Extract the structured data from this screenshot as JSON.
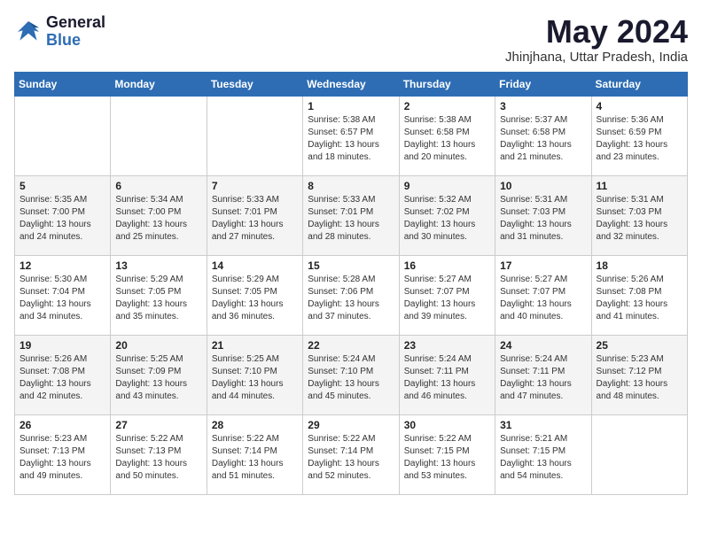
{
  "header": {
    "logo_general": "General",
    "logo_blue": "Blue",
    "month_title": "May 2024",
    "location": "Jhinjhana, Uttar Pradesh, India"
  },
  "days_of_week": [
    "Sunday",
    "Monday",
    "Tuesday",
    "Wednesday",
    "Thursday",
    "Friday",
    "Saturday"
  ],
  "weeks": [
    [
      {
        "day": "",
        "sunrise": "",
        "sunset": "",
        "daylight": ""
      },
      {
        "day": "",
        "sunrise": "",
        "sunset": "",
        "daylight": ""
      },
      {
        "day": "",
        "sunrise": "",
        "sunset": "",
        "daylight": ""
      },
      {
        "day": "1",
        "sunrise": "Sunrise: 5:38 AM",
        "sunset": "Sunset: 6:57 PM",
        "daylight": "Daylight: 13 hours and 18 minutes."
      },
      {
        "day": "2",
        "sunrise": "Sunrise: 5:38 AM",
        "sunset": "Sunset: 6:58 PM",
        "daylight": "Daylight: 13 hours and 20 minutes."
      },
      {
        "day": "3",
        "sunrise": "Sunrise: 5:37 AM",
        "sunset": "Sunset: 6:58 PM",
        "daylight": "Daylight: 13 hours and 21 minutes."
      },
      {
        "day": "4",
        "sunrise": "Sunrise: 5:36 AM",
        "sunset": "Sunset: 6:59 PM",
        "daylight": "Daylight: 13 hours and 23 minutes."
      }
    ],
    [
      {
        "day": "5",
        "sunrise": "Sunrise: 5:35 AM",
        "sunset": "Sunset: 7:00 PM",
        "daylight": "Daylight: 13 hours and 24 minutes."
      },
      {
        "day": "6",
        "sunrise": "Sunrise: 5:34 AM",
        "sunset": "Sunset: 7:00 PM",
        "daylight": "Daylight: 13 hours and 25 minutes."
      },
      {
        "day": "7",
        "sunrise": "Sunrise: 5:33 AM",
        "sunset": "Sunset: 7:01 PM",
        "daylight": "Daylight: 13 hours and 27 minutes."
      },
      {
        "day": "8",
        "sunrise": "Sunrise: 5:33 AM",
        "sunset": "Sunset: 7:01 PM",
        "daylight": "Daylight: 13 hours and 28 minutes."
      },
      {
        "day": "9",
        "sunrise": "Sunrise: 5:32 AM",
        "sunset": "Sunset: 7:02 PM",
        "daylight": "Daylight: 13 hours and 30 minutes."
      },
      {
        "day": "10",
        "sunrise": "Sunrise: 5:31 AM",
        "sunset": "Sunset: 7:03 PM",
        "daylight": "Daylight: 13 hours and 31 minutes."
      },
      {
        "day": "11",
        "sunrise": "Sunrise: 5:31 AM",
        "sunset": "Sunset: 7:03 PM",
        "daylight": "Daylight: 13 hours and 32 minutes."
      }
    ],
    [
      {
        "day": "12",
        "sunrise": "Sunrise: 5:30 AM",
        "sunset": "Sunset: 7:04 PM",
        "daylight": "Daylight: 13 hours and 34 minutes."
      },
      {
        "day": "13",
        "sunrise": "Sunrise: 5:29 AM",
        "sunset": "Sunset: 7:05 PM",
        "daylight": "Daylight: 13 hours and 35 minutes."
      },
      {
        "day": "14",
        "sunrise": "Sunrise: 5:29 AM",
        "sunset": "Sunset: 7:05 PM",
        "daylight": "Daylight: 13 hours and 36 minutes."
      },
      {
        "day": "15",
        "sunrise": "Sunrise: 5:28 AM",
        "sunset": "Sunset: 7:06 PM",
        "daylight": "Daylight: 13 hours and 37 minutes."
      },
      {
        "day": "16",
        "sunrise": "Sunrise: 5:27 AM",
        "sunset": "Sunset: 7:07 PM",
        "daylight": "Daylight: 13 hours and 39 minutes."
      },
      {
        "day": "17",
        "sunrise": "Sunrise: 5:27 AM",
        "sunset": "Sunset: 7:07 PM",
        "daylight": "Daylight: 13 hours and 40 minutes."
      },
      {
        "day": "18",
        "sunrise": "Sunrise: 5:26 AM",
        "sunset": "Sunset: 7:08 PM",
        "daylight": "Daylight: 13 hours and 41 minutes."
      }
    ],
    [
      {
        "day": "19",
        "sunrise": "Sunrise: 5:26 AM",
        "sunset": "Sunset: 7:08 PM",
        "daylight": "Daylight: 13 hours and 42 minutes."
      },
      {
        "day": "20",
        "sunrise": "Sunrise: 5:25 AM",
        "sunset": "Sunset: 7:09 PM",
        "daylight": "Daylight: 13 hours and 43 minutes."
      },
      {
        "day": "21",
        "sunrise": "Sunrise: 5:25 AM",
        "sunset": "Sunset: 7:10 PM",
        "daylight": "Daylight: 13 hours and 44 minutes."
      },
      {
        "day": "22",
        "sunrise": "Sunrise: 5:24 AM",
        "sunset": "Sunset: 7:10 PM",
        "daylight": "Daylight: 13 hours and 45 minutes."
      },
      {
        "day": "23",
        "sunrise": "Sunrise: 5:24 AM",
        "sunset": "Sunset: 7:11 PM",
        "daylight": "Daylight: 13 hours and 46 minutes."
      },
      {
        "day": "24",
        "sunrise": "Sunrise: 5:24 AM",
        "sunset": "Sunset: 7:11 PM",
        "daylight": "Daylight: 13 hours and 47 minutes."
      },
      {
        "day": "25",
        "sunrise": "Sunrise: 5:23 AM",
        "sunset": "Sunset: 7:12 PM",
        "daylight": "Daylight: 13 hours and 48 minutes."
      }
    ],
    [
      {
        "day": "26",
        "sunrise": "Sunrise: 5:23 AM",
        "sunset": "Sunset: 7:13 PM",
        "daylight": "Daylight: 13 hours and 49 minutes."
      },
      {
        "day": "27",
        "sunrise": "Sunrise: 5:22 AM",
        "sunset": "Sunset: 7:13 PM",
        "daylight": "Daylight: 13 hours and 50 minutes."
      },
      {
        "day": "28",
        "sunrise": "Sunrise: 5:22 AM",
        "sunset": "Sunset: 7:14 PM",
        "daylight": "Daylight: 13 hours and 51 minutes."
      },
      {
        "day": "29",
        "sunrise": "Sunrise: 5:22 AM",
        "sunset": "Sunset: 7:14 PM",
        "daylight": "Daylight: 13 hours and 52 minutes."
      },
      {
        "day": "30",
        "sunrise": "Sunrise: 5:22 AM",
        "sunset": "Sunset: 7:15 PM",
        "daylight": "Daylight: 13 hours and 53 minutes."
      },
      {
        "day": "31",
        "sunrise": "Sunrise: 5:21 AM",
        "sunset": "Sunset: 7:15 PM",
        "daylight": "Daylight: 13 hours and 54 minutes."
      },
      {
        "day": "",
        "sunrise": "",
        "sunset": "",
        "daylight": ""
      }
    ]
  ]
}
